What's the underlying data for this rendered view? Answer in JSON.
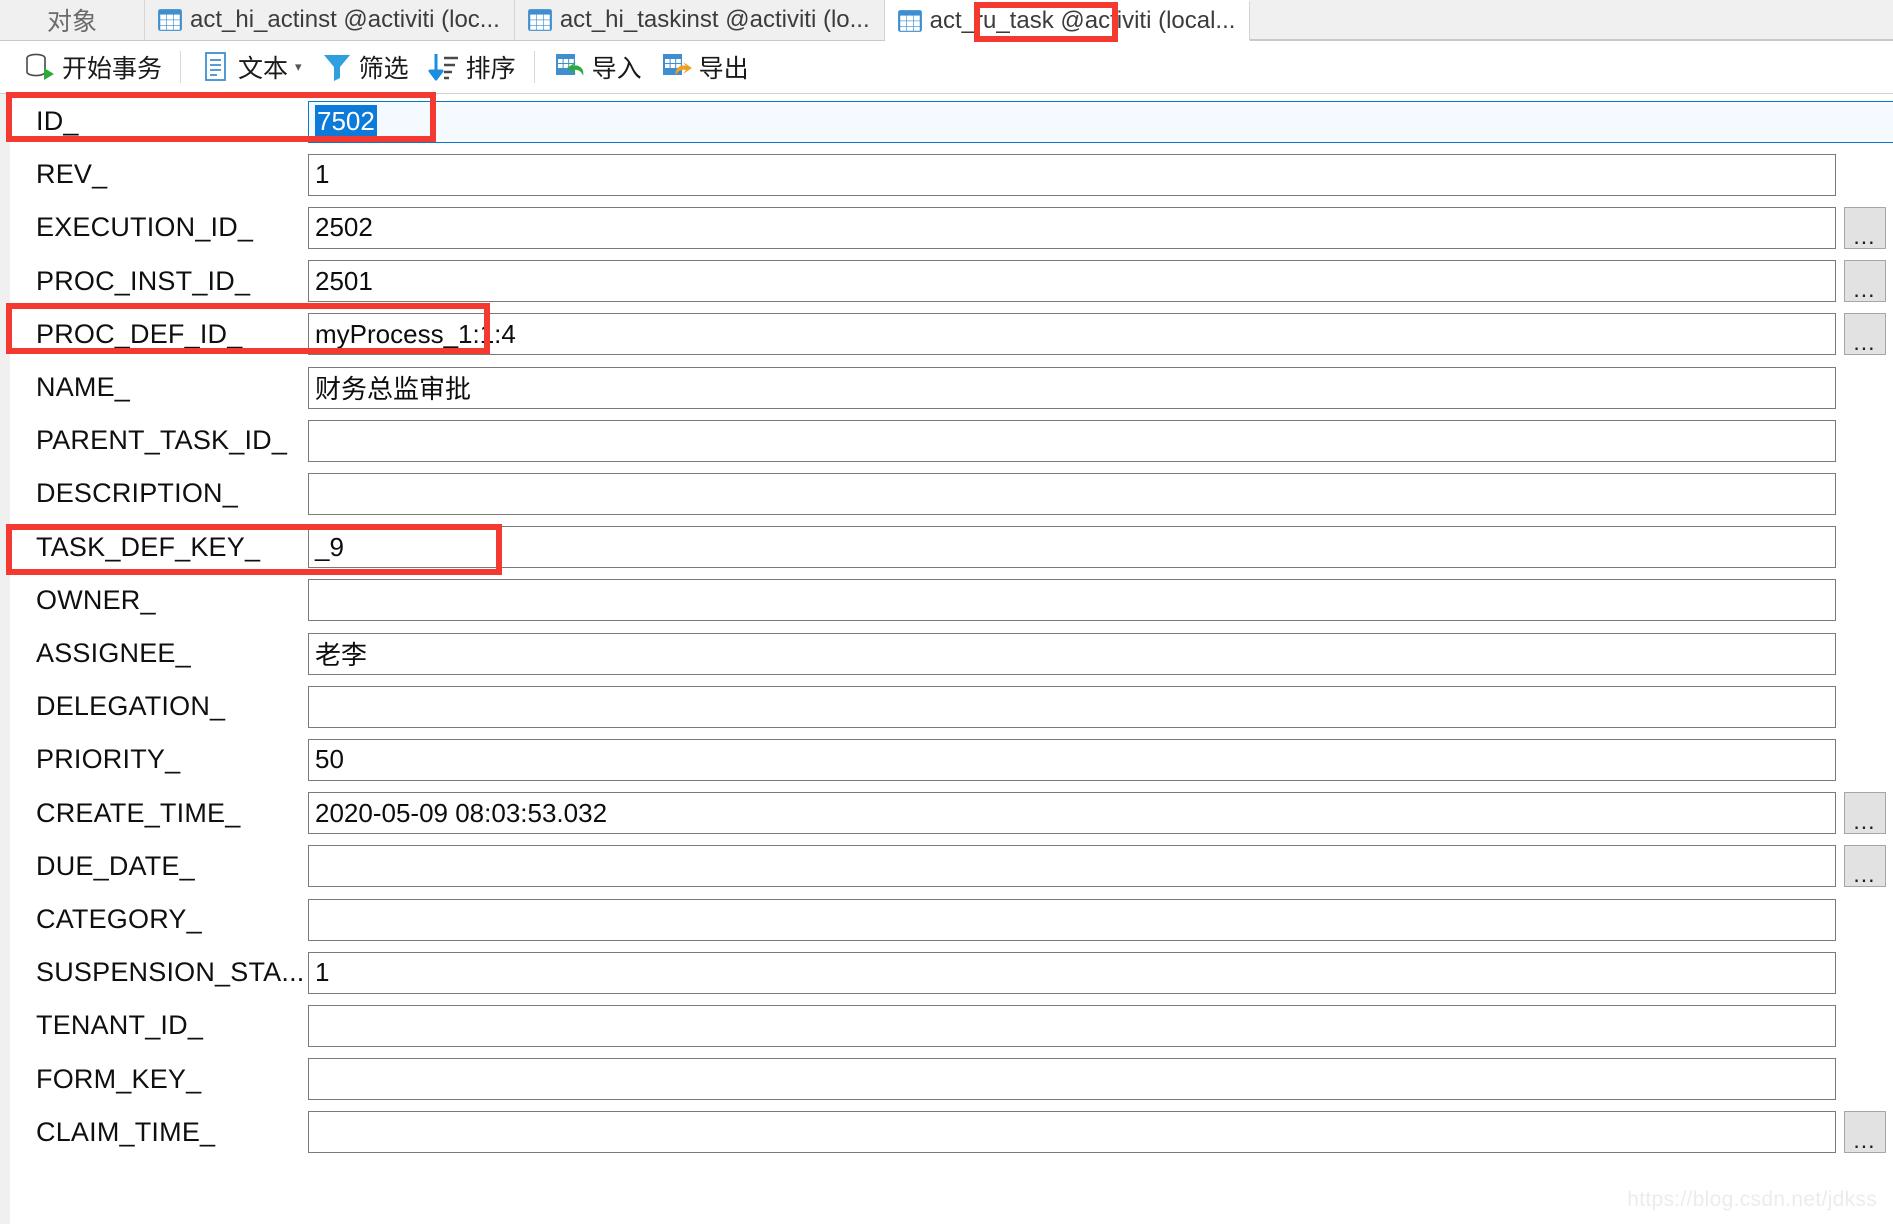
{
  "window": {
    "objects_label": "对象"
  },
  "tabs": [
    {
      "label": "act_hi_actinst @activiti (loc...",
      "icon": "table-grid-icon",
      "active": false
    },
    {
      "label": "act_hi_taskinst @activiti (lo...",
      "icon": "table-grid-icon",
      "active": false
    },
    {
      "label": "act_ru_task @activiti (local...",
      "icon": "table-grid-icon",
      "active": true
    }
  ],
  "toolbar": [
    {
      "label": "开始事务",
      "icon": "begin-transaction-icon",
      "caret": false
    },
    {
      "label": "文本",
      "icon": "text-icon",
      "caret": true
    },
    {
      "label": "筛选",
      "icon": "filter-icon",
      "caret": false
    },
    {
      "label": "排序",
      "icon": "sort-icon",
      "caret": false
    },
    {
      "label": "导入",
      "icon": "import-icon",
      "caret": false
    },
    {
      "label": "导出",
      "icon": "export-icon",
      "caret": false
    }
  ],
  "form": {
    "fields": [
      {
        "label": "ID_",
        "value": "7502",
        "focused": true,
        "selected": true,
        "ellipsis": false
      },
      {
        "label": "REV_",
        "value": "1",
        "focused": false,
        "selected": false,
        "ellipsis": false
      },
      {
        "label": "EXECUTION_ID_",
        "value": "2502",
        "focused": false,
        "selected": false,
        "ellipsis": true
      },
      {
        "label": "PROC_INST_ID_",
        "value": "2501",
        "focused": false,
        "selected": false,
        "ellipsis": true
      },
      {
        "label": "PROC_DEF_ID_",
        "value": "myProcess_1:1:4",
        "focused": false,
        "selected": false,
        "ellipsis": true
      },
      {
        "label": "NAME_",
        "value": "财务总监审批",
        "focused": false,
        "selected": false,
        "ellipsis": false
      },
      {
        "label": "PARENT_TASK_ID_",
        "value": "",
        "focused": false,
        "selected": false,
        "ellipsis": false
      },
      {
        "label": "DESCRIPTION_",
        "value": "",
        "focused": false,
        "selected": false,
        "ellipsis": false
      },
      {
        "label": "TASK_DEF_KEY_",
        "value": "_9",
        "focused": false,
        "selected": false,
        "ellipsis": false
      },
      {
        "label": "OWNER_",
        "value": "",
        "focused": false,
        "selected": false,
        "ellipsis": false
      },
      {
        "label": "ASSIGNEE_",
        "value": "老李",
        "focused": false,
        "selected": false,
        "ellipsis": false
      },
      {
        "label": "DELEGATION_",
        "value": "",
        "focused": false,
        "selected": false,
        "ellipsis": false
      },
      {
        "label": "PRIORITY_",
        "value": "50",
        "focused": false,
        "selected": false,
        "ellipsis": false
      },
      {
        "label": "CREATE_TIME_",
        "value": "2020-05-09 08:03:53.032",
        "focused": false,
        "selected": false,
        "ellipsis": true
      },
      {
        "label": "DUE_DATE_",
        "value": "",
        "focused": false,
        "selected": false,
        "ellipsis": true
      },
      {
        "label": "CATEGORY_",
        "value": "",
        "focused": false,
        "selected": false,
        "ellipsis": false
      },
      {
        "label": "SUSPENSION_STA...",
        "value": "1",
        "focused": false,
        "selected": false,
        "ellipsis": false
      },
      {
        "label": "TENANT_ID_",
        "value": "",
        "focused": false,
        "selected": false,
        "ellipsis": false
      },
      {
        "label": "FORM_KEY_",
        "value": "",
        "focused": false,
        "selected": false,
        "ellipsis": false
      },
      {
        "label": "CLAIM_TIME_",
        "value": "",
        "focused": false,
        "selected": false,
        "ellipsis": true
      }
    ],
    "ellipsis_label": "..."
  },
  "annotations": [
    {
      "target": "tab-act-ru-task"
    },
    {
      "target": "field-row-ID_"
    },
    {
      "target": "field-row-NAME_"
    },
    {
      "target": "field-row-ASSIGNEE_"
    }
  ],
  "watermark": "https://blog.csdn.net/jdkss",
  "colors": {
    "accent": "#0b7ad8",
    "annotation": "#f43a30",
    "tab_bar_bg": "#f0f0f0",
    "field_border": "#7a7a7a"
  }
}
